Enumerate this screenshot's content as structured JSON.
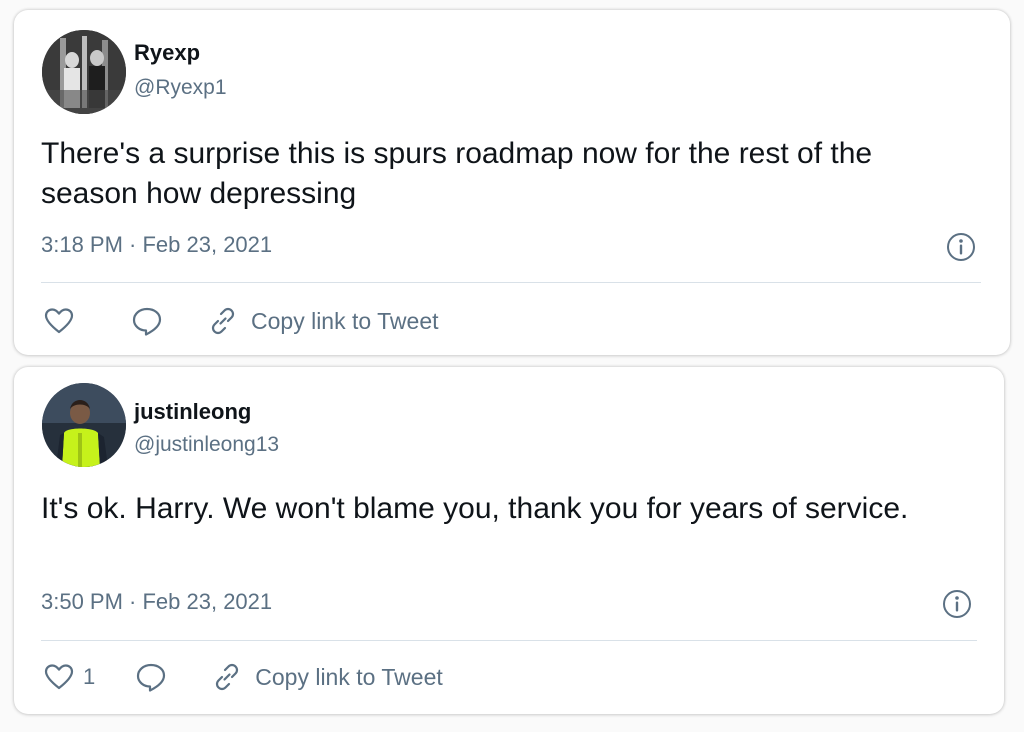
{
  "tweets": [
    {
      "display_name": "Ryexp",
      "handle": "@Ryexp1",
      "text": "There's a surprise this is spurs roadmap now for the rest of the season how depressing",
      "timestamp": "3:18 PM · Feb 23, 2021",
      "like_count": "",
      "copy_link_label": "Copy link to Tweet"
    },
    {
      "display_name": "justinleong",
      "handle": "@justinleong13",
      "text": "It's ok. Harry. We won't blame you, thank you for years of service.",
      "timestamp": "3:50 PM · Feb 23, 2021",
      "like_count": "1",
      "copy_link_label": "Copy link to Tweet"
    }
  ],
  "icons": [
    "heart-icon",
    "reply-icon",
    "link-icon",
    "info-icon"
  ],
  "colors": {
    "text_primary": "#0f1419",
    "text_secondary": "#5b7083",
    "divider": "#d9e1e8",
    "card_bg": "#ffffff"
  }
}
